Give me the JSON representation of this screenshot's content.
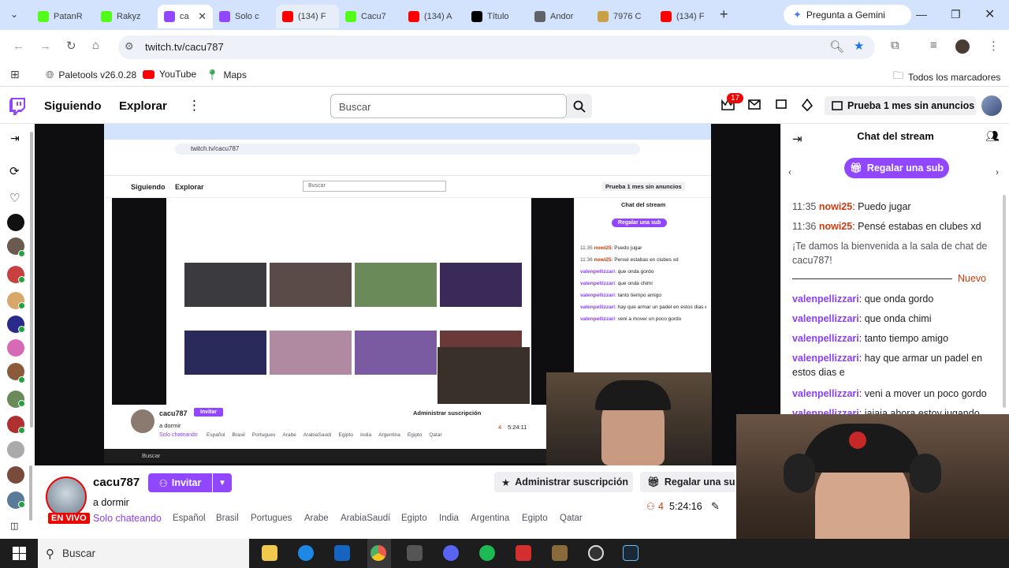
{
  "tabs": [
    {
      "title": "PatanR",
      "favicon": "kick-icon",
      "color": "#53fc18"
    },
    {
      "title": "Rakyz",
      "favicon": "kick-icon",
      "color": "#53fc18"
    },
    {
      "title": "ca",
      "favicon": "twitch-icon",
      "color": "#9147ff",
      "active": true
    },
    {
      "title": "Solo c",
      "favicon": "twitch-icon",
      "color": "#9147ff"
    },
    {
      "title": "(134) F",
      "favicon": "youtube-icon",
      "color": "#ff0000"
    },
    {
      "title": "Cacu7",
      "favicon": "kick-icon",
      "color": "#53fc18"
    },
    {
      "title": "(134) A",
      "favicon": "youtube-icon",
      "color": "#ff0000"
    },
    {
      "title": "Título",
      "favicon": "tiktok-icon",
      "color": "#000000"
    },
    {
      "title": "Andor",
      "favicon": "link-icon",
      "color": "#5f6368"
    },
    {
      "title": "7976 C",
      "favicon": "coin-icon",
      "color": "#c8a146"
    },
    {
      "title": "(134) F",
      "favicon": "youtube-icon",
      "color": "#ff0000"
    }
  ],
  "gemini_label": "Pregunta a Gemini",
  "url": "twitch.tv/cacu787",
  "bookmarks": {
    "items": [
      {
        "label": "Paletools v26.0.28"
      },
      {
        "label": "YouTube"
      },
      {
        "label": "Maps"
      }
    ],
    "all": "Todos los marcadores"
  },
  "twitch": {
    "following": "Siguiendo",
    "explore": "Explorar",
    "search_placeholder": "Buscar",
    "notifications": "17",
    "promo": "Prueba 1 mes sin anuncios"
  },
  "chat": {
    "title": "Chat del stream",
    "gift": "Regalar una sub",
    "new_label": "Nuevo",
    "messages": [
      {
        "time": "11:35",
        "user": "nowi25",
        "text": ": Puedo jugar"
      },
      {
        "time": "11:36",
        "user": "nowi25",
        "text": ": Pensé estabas en clubes xd"
      },
      {
        "system": "¡Te damos la bienvenida a la sala de chat de cacu787!"
      },
      {
        "user": "valenpellizzari",
        "text": ": que onda gordo"
      },
      {
        "user": "valenpellizzari",
        "text": ": que onda chimi"
      },
      {
        "user": "valenpellizzari",
        "text": ": tanto tiempo amigo"
      },
      {
        "user": "valenpellizzari",
        "text": ": hay que armar un padel en estos dias e"
      },
      {
        "user": "valenpellizzari",
        "text": ": veni a mover un poco gordo"
      },
      {
        "user": "valenpellizzari",
        "text": ": jajaja ahora estoy jugando"
      }
    ]
  },
  "channel": {
    "name": "cacu787",
    "invite": "Invitar",
    "title": "a dormir",
    "live": "EN VIVO",
    "category": "Solo chateando",
    "tags": [
      "Español",
      "Brasil",
      "Portugues",
      "Arabe",
      "ArabiaSaudí",
      "Egipto",
      "India",
      "Argentina",
      "Egipto",
      "Qatar"
    ],
    "manage_sub": "Administrar suscripción",
    "gift_sub": "Regalar una sub",
    "viewers": "4",
    "uptime": "5:24:16"
  },
  "taskbar": {
    "search": "Buscar"
  },
  "nested": {
    "url": "twitch.tv/cacu787",
    "following": "Siguiendo",
    "explore": "Explorar",
    "search": "Buscar",
    "promo": "Prueba 1 mes sin anuncios",
    "chat_title": "Chat del stream",
    "gift": "Regalar una sub",
    "channel": "cacu787",
    "invite": "Invitar",
    "status": "a dormir",
    "category": "Solo chateando",
    "manage": "Administrar suscripción",
    "uptime": "5:24:11",
    "viewers": "4",
    "taskbar_search": "Buscar",
    "tags": [
      "Español",
      "Brasil",
      "Portugues",
      "Arabe",
      "ArabiaSaudí",
      "Egipto",
      "India",
      "Argentina",
      "Egipto",
      "Qatar"
    ],
    "chat_lines": [
      {
        "time": "11:35",
        "user": "nowi25",
        "text": ": Puedo jugar"
      },
      {
        "time": "11:36",
        "user": "nowi25",
        "text": ": Pensé estabas en clubes xd"
      },
      {
        "user": "valenpellizzari",
        "text": ": que onda gordo"
      },
      {
        "user": "valenpellizzari",
        "text": ": que onda chimi"
      },
      {
        "user": "valenpellizzari",
        "text": ": tanto tiempo amigo"
      },
      {
        "user": "valenpellizzari",
        "text": ": hay que armar un padel en estos dias e"
      },
      {
        "user": "valenpellizzari",
        "text": ": veni a mover un poco gordo"
      }
    ]
  }
}
